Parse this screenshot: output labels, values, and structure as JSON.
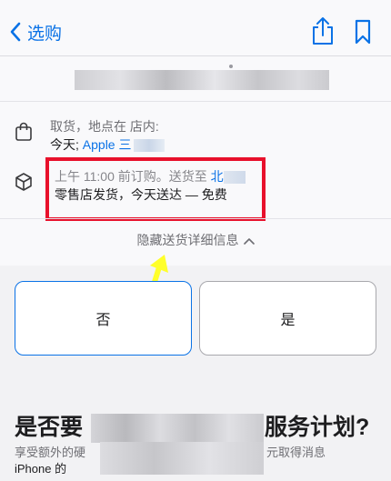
{
  "nav": {
    "back_label": "选购"
  },
  "pickup": {
    "label": "取货，地点在 店内:",
    "value_prefix": "今天; ",
    "value_link": "Apple 三"
  },
  "delivery": {
    "order_text": "上午 11:00 前订购。送货至 ",
    "order_link": "北",
    "ship_text": "零售店发货，今天送达 — 免费"
  },
  "details_toggle": {
    "label": "隐藏送货详细信息"
  },
  "options": {
    "no_label": "否",
    "yes_label": "是"
  },
  "bottom": {
    "title_start": "是否要",
    "title_end": "服务计划?",
    "sub1": "享受额外的硬",
    "sub2": "iPhone 的",
    "sub_right": "元取得消息"
  },
  "colors": {
    "accent": "#0a72e6",
    "highlight": "#e8102b",
    "arrow": "#ffff2a"
  },
  "icons": {
    "back": "chevron-left-icon",
    "share": "share-icon",
    "bookmark": "bookmark-icon",
    "pickup": "shopping-bag-icon",
    "delivery": "box-icon",
    "toggle": "chevron-up-icon"
  }
}
